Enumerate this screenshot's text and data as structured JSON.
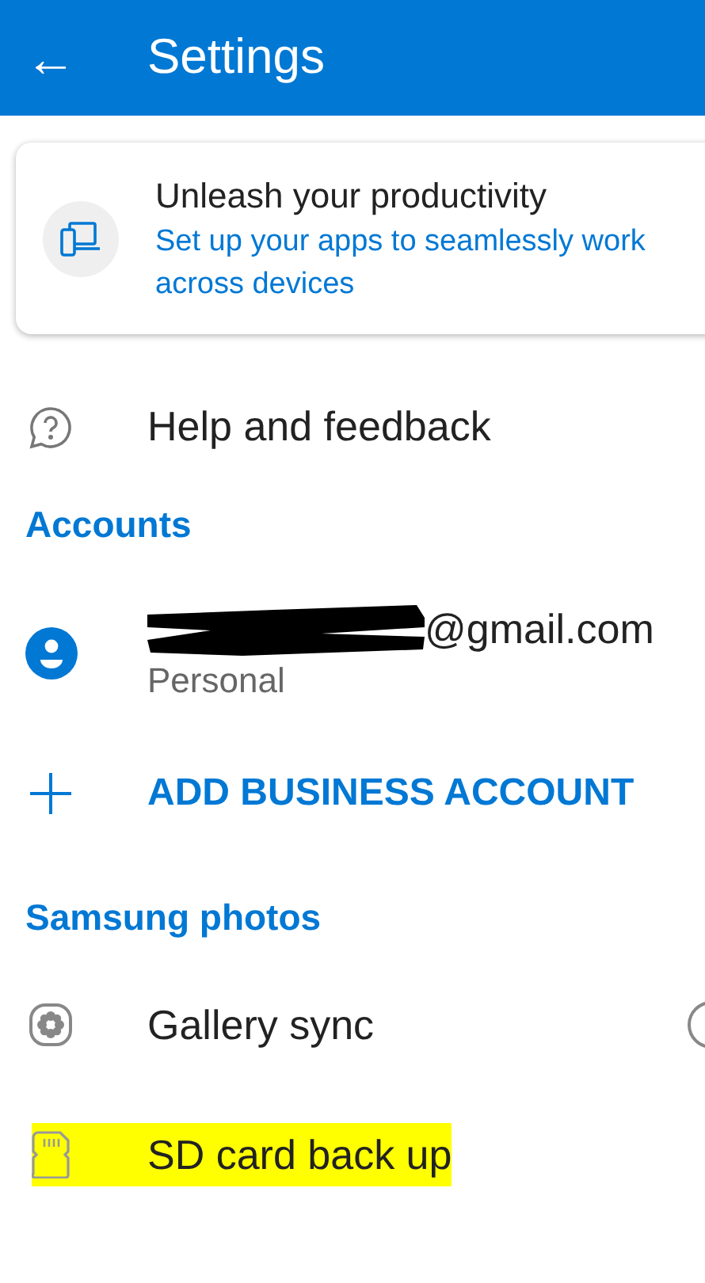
{
  "header": {
    "back_icon": "←",
    "title": "Settings"
  },
  "promo_card": {
    "title": "Unleash your productivity",
    "subtitle": "Set up your apps to seamlessly work across devices"
  },
  "help_item": {
    "label": "Help and feedback"
  },
  "accounts_section": {
    "heading": "Accounts",
    "account": {
      "email_visible": "@gmail.com",
      "redacted": true,
      "type": "Personal"
    },
    "add_action": {
      "label": "ADD BUSINESS ACCOUNT"
    }
  },
  "samsung_section": {
    "heading": "Samsung photos",
    "items": [
      {
        "kind": "toggle",
        "label": "Gallery sync",
        "on": false,
        "highlighted": false
      },
      {
        "kind": "plain",
        "label": "SD card back up",
        "highlighted": true
      }
    ]
  }
}
